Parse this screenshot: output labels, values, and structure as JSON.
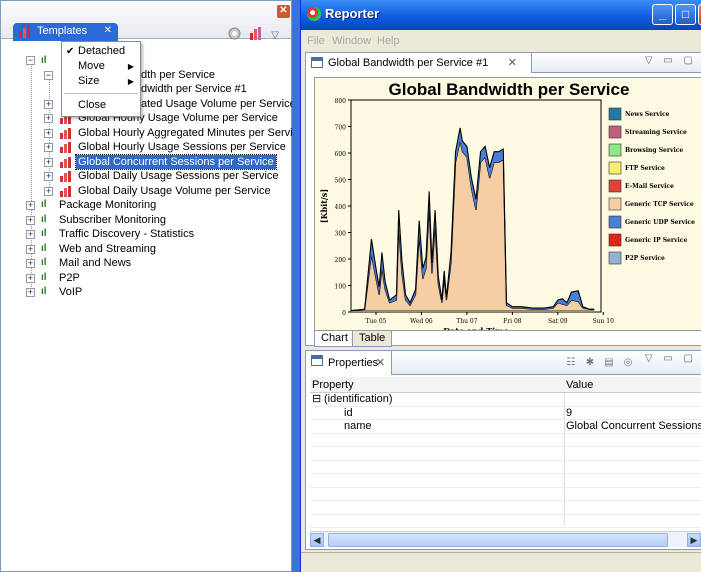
{
  "templates_view": {
    "tab_label": "Templates",
    "tab_close": "✕",
    "view_close": "✕",
    "menu_arrow": "▽",
    "popup_menu": {
      "items": [
        {
          "label": "Detached",
          "checked": true,
          "check": "✔"
        },
        {
          "label": "Move",
          "submenu": true,
          "arrow": "▶"
        },
        {
          "label": "Size",
          "submenu": true,
          "arrow": "▶"
        },
        {
          "label": "Close"
        }
      ]
    },
    "tree": {
      "items": [
        {
          "label": "dth per Service",
          "level": 2
        },
        {
          "label": "dwidth per Service #1",
          "level": 3
        },
        {
          "label": "ated Usage Volume per Service",
          "level": 2
        },
        {
          "label": "Global Hourly Usage Volume per Service",
          "level": 2
        },
        {
          "label": "Global Hourly Aggregated Minutes per Service",
          "level": 2
        },
        {
          "label": "Global Hourly Usage Sessions per Service",
          "level": 2
        },
        {
          "label": "Global Concurrent Sessions per Service",
          "level": 2,
          "selected": true
        },
        {
          "label": "Global Daily Usage Sessions per Service",
          "level": 2
        },
        {
          "label": "Global Daily Usage Volume per Service",
          "level": 2
        },
        {
          "label": "Package Monitoring",
          "level": 1
        },
        {
          "label": "Subscriber Monitoring",
          "level": 1
        },
        {
          "label": "Traffic Discovery - Statistics",
          "level": 1
        },
        {
          "label": "Web and Streaming",
          "level": 1
        },
        {
          "label": "Mail and News",
          "level": 1
        },
        {
          "label": "P2P",
          "level": 1
        },
        {
          "label": "VoIP",
          "level": 1
        }
      ]
    }
  },
  "reporter": {
    "title": "Reporter",
    "window_buttons": {
      "minimize": "_",
      "maximize": "□",
      "close": "✕"
    },
    "menu": [
      "File",
      "Window",
      "Help"
    ],
    "editor_tab": {
      "label": "Global Bandwidth per Service #1",
      "close": "✕"
    },
    "pane_controls": "▽ ▭ ▢",
    "bottom_tabs": [
      "Chart",
      "Table"
    ],
    "properties_view": {
      "tab_label": "Properties",
      "close": "✕",
      "columns": [
        "Property",
        "Value"
      ],
      "rows": [
        {
          "property": "(identification)",
          "value": "",
          "group": true,
          "expander": "⊟"
        },
        {
          "property": "id",
          "value": "9"
        },
        {
          "property": "name",
          "value": "Global Concurrent Sessions per S"
        }
      ]
    },
    "scroll_left": "◀",
    "scroll_right": "▶"
  },
  "chart_data": {
    "type": "area",
    "title": "Global Bandwidth per Service",
    "xlabel": "Date and Time",
    "ylabel": "[Kbit/s]",
    "ylim": [
      0,
      800
    ],
    "yticks": [
      0,
      100,
      200,
      300,
      400,
      500,
      600,
      700,
      800
    ],
    "xticks": [
      "Tue 05",
      "Wed 06",
      "Thu 07",
      "Fri 08",
      "Sat 09",
      "Sun 10"
    ],
    "x": [
      0,
      0.3,
      0.45,
      0.55,
      0.62,
      0.68,
      0.75,
      0.85,
      1.0,
      1.05,
      1.12,
      1.2,
      1.3,
      1.42,
      1.5,
      1.58,
      1.65,
      1.72,
      1.78,
      1.85,
      1.92,
      2.0,
      2.05,
      2.1,
      2.2,
      2.3,
      2.4,
      2.45,
      2.55,
      2.65,
      2.75,
      2.85,
      2.95,
      3.05,
      3.15,
      3.25,
      3.35,
      3.42,
      3.55,
      3.75,
      4.0,
      4.25,
      4.45,
      4.55,
      4.65,
      4.75,
      4.85,
      5.0,
      5.1,
      5.25,
      5.35
    ],
    "legend_position": "right",
    "series": [
      {
        "name": "News Service",
        "color": "#2279a8",
        "values": [
          0,
          0,
          0,
          0,
          0,
          0,
          0,
          0,
          0,
          0,
          0,
          0,
          0,
          0,
          0,
          0,
          0,
          0,
          0,
          0,
          0,
          0,
          0,
          0,
          0,
          0,
          0,
          0,
          0,
          0,
          0,
          0,
          0,
          0,
          0,
          0,
          0,
          0,
          0,
          0,
          0,
          0,
          0,
          0,
          0,
          0,
          0,
          0,
          0,
          0,
          0
        ]
      },
      {
        "name": "Streaming Service",
        "color": "#c0607e",
        "values": [
          0,
          0,
          0,
          0,
          0,
          0,
          0,
          0,
          0,
          0,
          0,
          0,
          0,
          0,
          0,
          0,
          0,
          0,
          0,
          0,
          0,
          0,
          0,
          0,
          0,
          0,
          0,
          0,
          0,
          0,
          0,
          0,
          0,
          0,
          0,
          0,
          0,
          0,
          0,
          0,
          0,
          0,
          0,
          0,
          0,
          0,
          0,
          0,
          0,
          0,
          0
        ]
      },
      {
        "name": "Browsing Service",
        "color": "#8ee889",
        "values": [
          5,
          5,
          5,
          5,
          5,
          5,
          5,
          5,
          5,
          5,
          5,
          5,
          5,
          5,
          5,
          5,
          5,
          5,
          5,
          5,
          5,
          5,
          5,
          5,
          5,
          5,
          5,
          5,
          5,
          5,
          5,
          5,
          5,
          5,
          5,
          5,
          5,
          5,
          5,
          5,
          5,
          5,
          5,
          5,
          5,
          5,
          5,
          5,
          5,
          5,
          5
        ]
      },
      {
        "name": "FTP Service",
        "color": "#f3ef6f",
        "values": [
          0,
          0,
          0,
          0,
          0,
          0,
          0,
          0,
          0,
          0,
          0,
          0,
          0,
          0,
          0,
          0,
          0,
          0,
          0,
          0,
          0,
          0,
          0,
          0,
          0,
          0,
          0,
          0,
          0,
          0,
          0,
          0,
          0,
          0,
          0,
          0,
          0,
          0,
          0,
          0,
          0,
          0,
          0,
          0,
          0,
          0,
          0,
          0,
          0,
          0,
          0
        ]
      },
      {
        "name": "E-Mail Service",
        "color": "#e2413a",
        "values": [
          0,
          0,
          0,
          0,
          0,
          0,
          0,
          0,
          0,
          0,
          0,
          0,
          0,
          0,
          0,
          0,
          0,
          0,
          0,
          0,
          0,
          0,
          0,
          0,
          0,
          0,
          0,
          0,
          0,
          0,
          0,
          0,
          0,
          0,
          0,
          0,
          0,
          0,
          0,
          0,
          0,
          0,
          0,
          0,
          0,
          0,
          0,
          0,
          0,
          0,
          0
        ]
      },
      {
        "name": "Generic TCP Service",
        "color": "#f5cfa3",
        "values": [
          0,
          5,
          210,
          120,
          60,
          160,
          80,
          30,
          40,
          310,
          140,
          40,
          20,
          60,
          280,
          120,
          160,
          390,
          140,
          320,
          100,
          30,
          120,
          40,
          180,
          560,
          640,
          600,
          580,
          460,
          380,
          560,
          580,
          500,
          560,
          560,
          570,
          20,
          10,
          10,
          5,
          5,
          10,
          30,
          25,
          20,
          40,
          35,
          10,
          5,
          5
        ]
      },
      {
        "name": "Generic UDP Service",
        "color": "#4a80d4",
        "values": [
          0,
          0,
          60,
          40,
          30,
          60,
          30,
          10,
          20,
          70,
          50,
          20,
          10,
          20,
          60,
          40,
          40,
          60,
          40,
          60,
          30,
          10,
          30,
          10,
          40,
          40,
          50,
          40,
          40,
          40,
          40,
          40,
          40,
          40,
          40,
          40,
          40,
          10,
          5,
          5,
          5,
          5,
          5,
          10,
          20,
          10,
          30,
          40,
          5,
          0,
          0
        ]
      },
      {
        "name": "Generic IP Service",
        "color": "#e02416",
        "values": [
          0,
          0,
          0,
          0,
          0,
          0,
          0,
          0,
          0,
          0,
          0,
          0,
          0,
          0,
          0,
          0,
          0,
          0,
          0,
          0,
          0,
          0,
          0,
          0,
          0,
          0,
          0,
          0,
          0,
          0,
          0,
          0,
          0,
          0,
          0,
          0,
          0,
          0,
          0,
          0,
          0,
          0,
          0,
          0,
          0,
          0,
          0,
          0,
          0,
          0,
          0
        ]
      },
      {
        "name": "P2P Service",
        "color": "#94b2d0",
        "values": [
          0,
          0,
          0,
          0,
          0,
          0,
          0,
          0,
          0,
          0,
          0,
          0,
          0,
          0,
          0,
          0,
          0,
          0,
          0,
          0,
          0,
          0,
          0,
          0,
          0,
          0,
          0,
          0,
          0,
          0,
          0,
          0,
          0,
          0,
          0,
          0,
          0,
          0,
          0,
          0,
          0,
          0,
          0,
          0,
          0,
          0,
          0,
          0,
          0,
          0,
          0
        ]
      }
    ]
  }
}
